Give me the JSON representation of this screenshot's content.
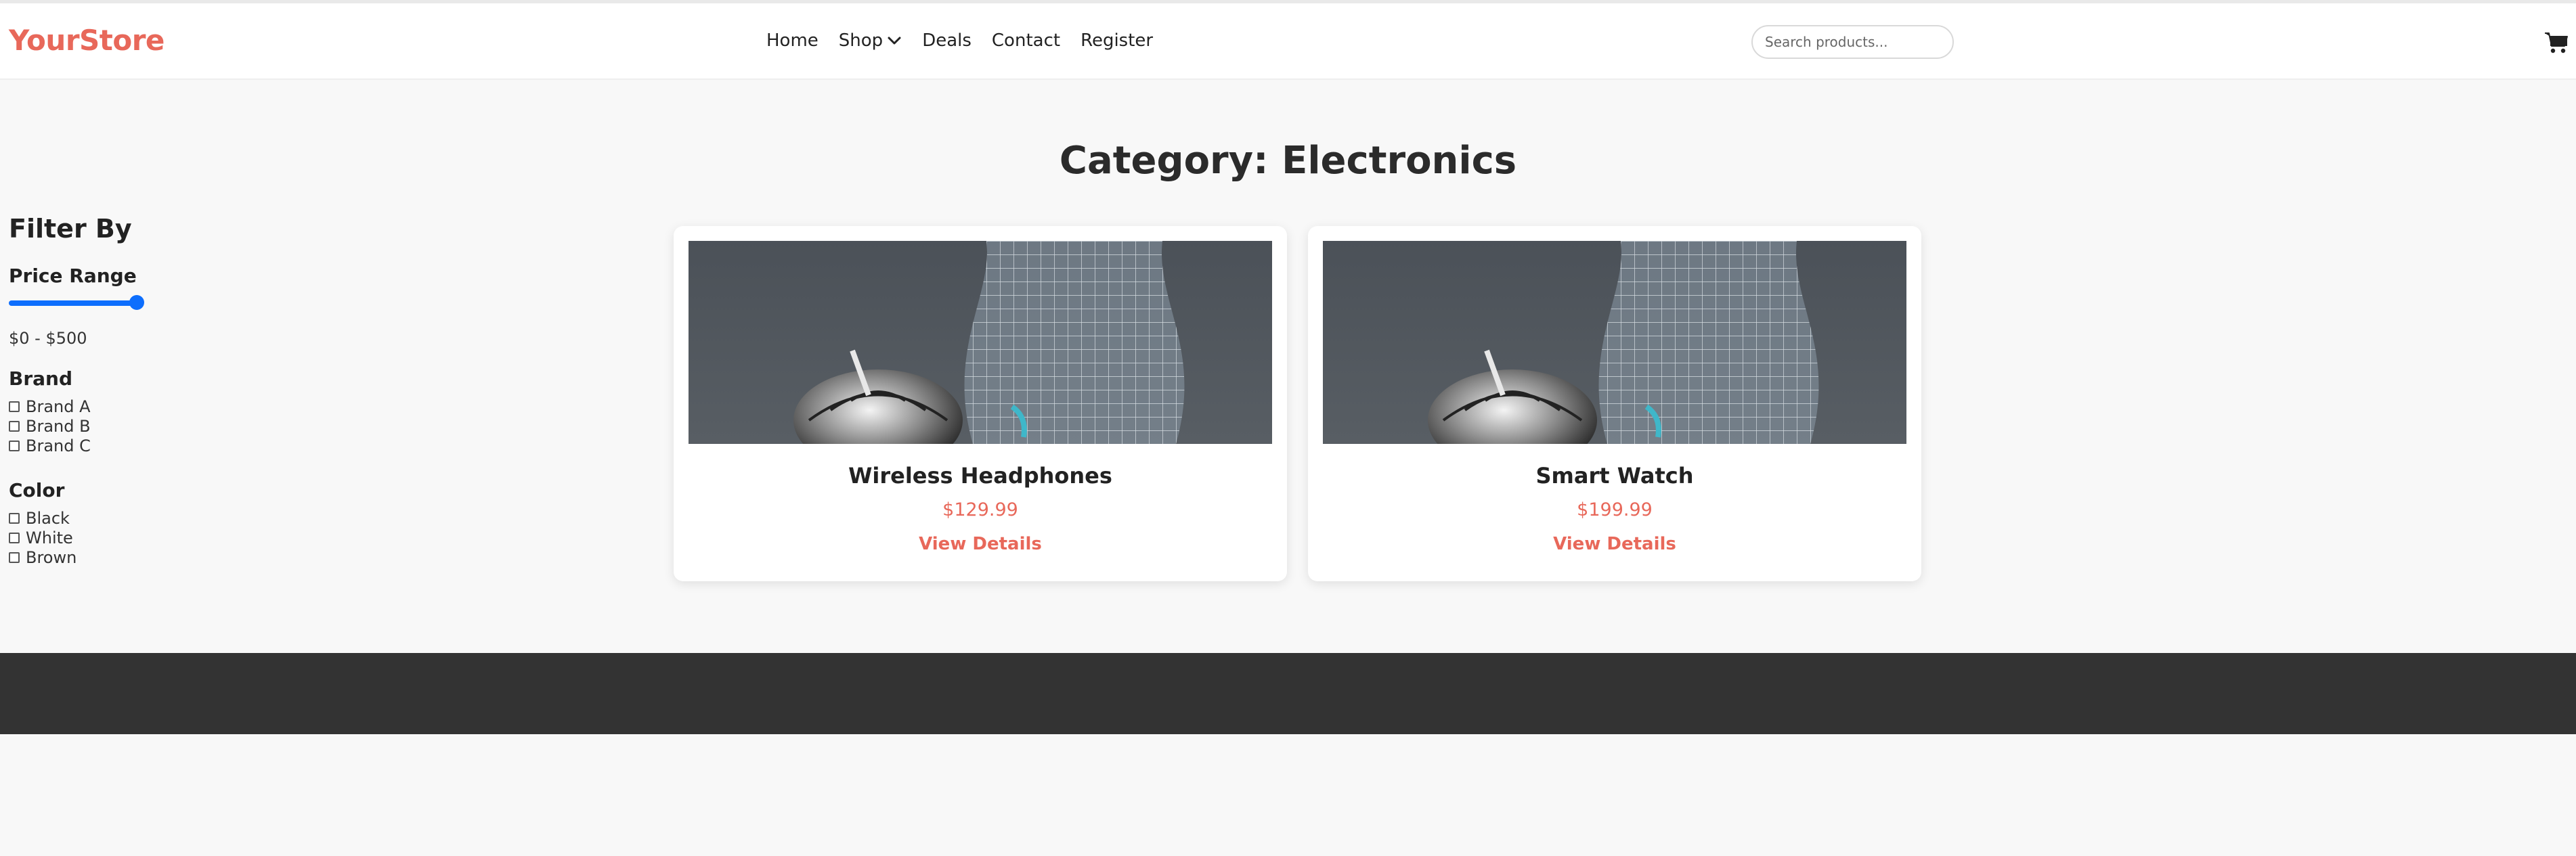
{
  "colors": {
    "brand": "#e8685a",
    "slider": "#0d6efd",
    "footer": "#333333"
  },
  "header": {
    "logo": "YourStore",
    "nav": [
      {
        "label": "Home"
      },
      {
        "label": "Shop",
        "icon": "chevron-down-icon"
      },
      {
        "label": "Deals"
      },
      {
        "label": "Contact"
      },
      {
        "label": "Register"
      }
    ],
    "search": {
      "placeholder": "Search products...",
      "value": ""
    },
    "cart_icon": "shopping-cart-icon"
  },
  "main": {
    "title": "Category: Electronics"
  },
  "sidebar": {
    "title": "Filter By",
    "price": {
      "label": "Price Range",
      "range_text": "$0 - $500",
      "slider_value_fraction": 1.0
    },
    "brand": {
      "label": "Brand",
      "options": [
        "Brand A",
        "Brand B",
        "Brand C"
      ]
    },
    "color": {
      "label": "Color",
      "options": [
        "Black",
        "White",
        "Brown"
      ]
    }
  },
  "products": [
    {
      "name": "Wireless Headphones",
      "price": "$129.99",
      "link": "View Details"
    },
    {
      "name": "Smart Watch",
      "price": "$199.99",
      "link": "View Details"
    }
  ]
}
